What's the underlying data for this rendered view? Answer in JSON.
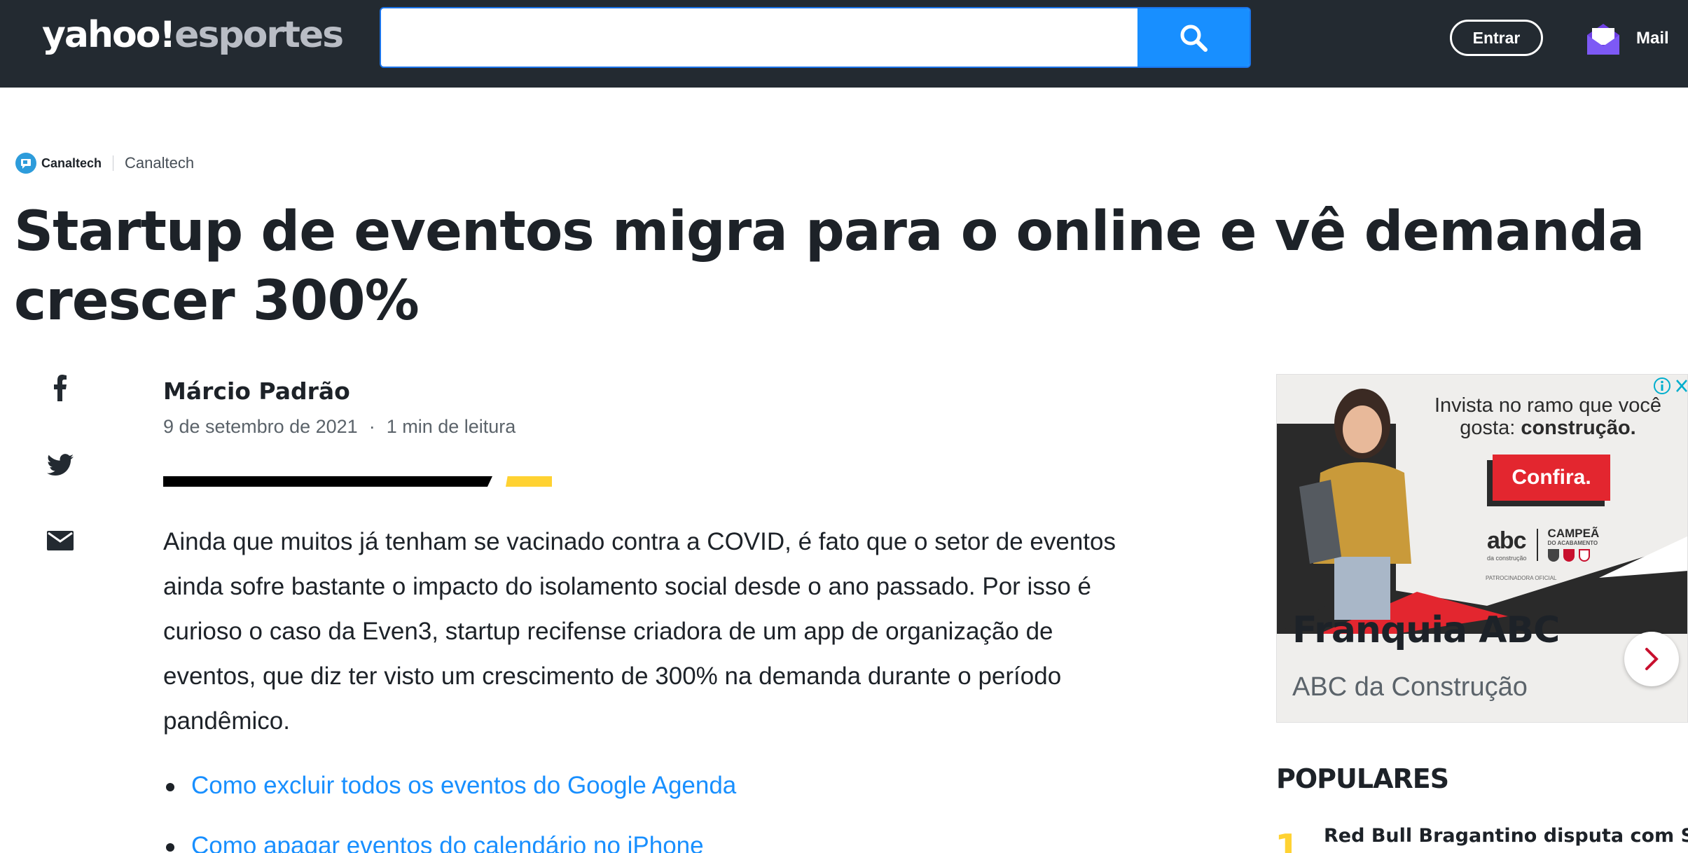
{
  "header": {
    "logo_main": "yahoo!",
    "logo_sub": "esportes",
    "search_value": "",
    "login_label": "Entrar",
    "mail_label": "Mail"
  },
  "article": {
    "source_brand": "Canaltech",
    "source_name": "Canaltech",
    "title": "Startup de eventos migra para o online e vê demanda crescer 300%",
    "author": "Márcio Padrão",
    "date": "9 de setembro de 2021",
    "meta_separator": "·",
    "read_time": "1 min de leitura",
    "body": "Ainda que muitos já tenham se vacinado contra a COVID, é fato que o setor de eventos ainda sofre bastante o impacto do isolamento social desde o ano passado. Por isso é curioso o caso da Even3, startup recifense criadora de um app de organização de eventos, que diz ter visto um crescimento de 300% na demanda durante o período pandêmico.",
    "related_links": [
      "Como excluir todos os eventos do Google Agenda",
      "Como apagar eventos do calendário no iPhone"
    ]
  },
  "share": {
    "icons": [
      "facebook-icon",
      "twitter-icon",
      "mail-icon"
    ]
  },
  "ad": {
    "headline_plain": "Invista no ramo que você gosta:",
    "headline_bold": "construção.",
    "cta": "Confira.",
    "brand_abc": "abc",
    "brand_abc_sub": "da construção",
    "brand_campea": "CAMPEÃ",
    "brand_campea_sub": "DO ACABAMENTO",
    "sponsor_note": "PATROCINADORA OFICIAL",
    "title": "Franquia ABC",
    "subtitle": "ABC da Construção"
  },
  "sidebar": {
    "populares_title": "POPULARES",
    "items": [
      {
        "rank": "1",
        "title": "Red Bull Bragantino disputa com Santo"
      }
    ]
  },
  "colors": {
    "topbar": "#232a31",
    "search_button": "#188fff",
    "link": "#188fff",
    "accent_yellow": "#ffd232",
    "ad_red": "#e3262f"
  }
}
